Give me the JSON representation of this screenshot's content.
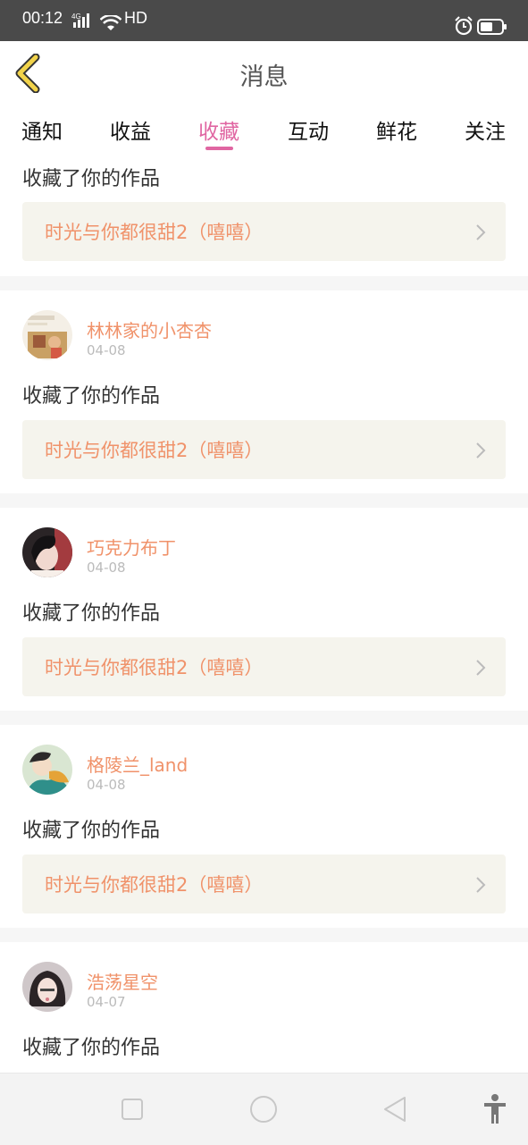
{
  "status_bar": {
    "time": "00:12",
    "network": "4G",
    "hd": "HD"
  },
  "header": {
    "title": "消息"
  },
  "tabs": [
    {
      "label": "通知"
    },
    {
      "label": "收益"
    },
    {
      "label": "收藏",
      "active": true
    },
    {
      "label": "互动"
    },
    {
      "label": "鲜花"
    },
    {
      "label": "关注"
    }
  ],
  "items": [
    {
      "action": "收藏了你的作品",
      "work_title": "时光与你都很甜2（嘻嘻）"
    },
    {
      "username": "林林家的小杏杏",
      "date": "04-08",
      "action": "收藏了你的作品",
      "work_title": "时光与你都很甜2（嘻嘻）"
    },
    {
      "username": "巧克力布丁",
      "date": "04-08",
      "action": "收藏了你的作品",
      "work_title": "时光与你都很甜2（嘻嘻）"
    },
    {
      "username": "格陵兰_land",
      "date": "04-08",
      "action": "收藏了你的作品",
      "work_title": "时光与你都很甜2（嘻嘻）"
    },
    {
      "username": "浩荡星空",
      "date": "04-07",
      "action": "收藏了你的作品"
    }
  ],
  "colors": {
    "accent_pink": "#e066a2",
    "username_orange": "#f0926a",
    "work_bg": "#f5f4ed",
    "back_arrow_yellow": "#f2d34a"
  },
  "icons": {
    "back": "chevron-left-icon",
    "work_arrow": "chevron-right-icon",
    "sys_recent": "square-icon",
    "sys_home": "circle-icon",
    "sys_back": "triangle-back-icon",
    "accessibility": "accessibility-icon"
  }
}
